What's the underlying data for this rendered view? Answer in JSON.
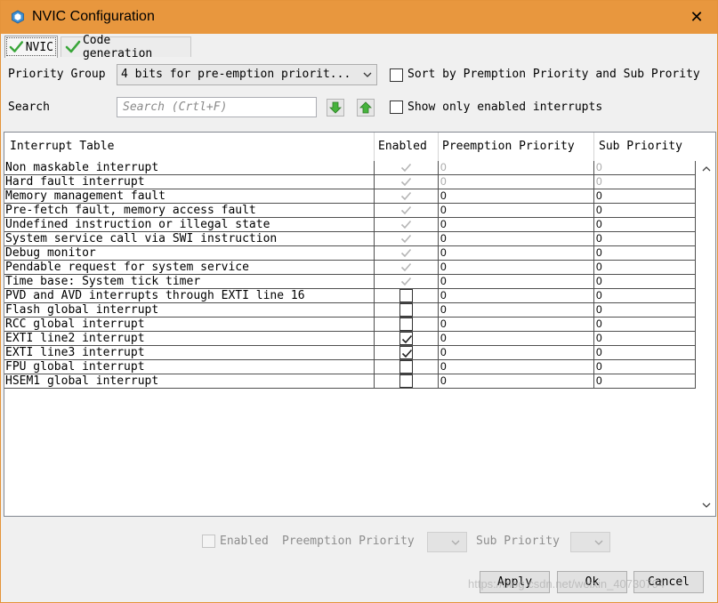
{
  "window": {
    "title": "NVIC Configuration",
    "close_glyph": "✕",
    "accent": "#e8973e"
  },
  "tabs": [
    {
      "label": "NVIC",
      "icon": "green-check-icon"
    },
    {
      "label": "Code generation",
      "icon": "green-check-icon"
    }
  ],
  "controls": {
    "priority_group_label": "Priority Group",
    "priority_group_value": "4 bits for pre-emption priorit...",
    "sort_label": "Sort by Premption Priority and Sub Prority",
    "search_label": "Search",
    "search_placeholder": "Search (Crtl+F)",
    "show_enabled_label": "Show only enabled interrupts"
  },
  "table": {
    "headers": [
      "Interrupt Table",
      "Enabled",
      "Preemption Priority",
      "Sub Priority"
    ],
    "rows": [
      {
        "name": "Non maskable interrupt",
        "enabled": true,
        "locked": true,
        "preemption": "0",
        "sub": "0",
        "pre_dim": true,
        "sub_dim": true
      },
      {
        "name": "Hard fault interrupt",
        "enabled": true,
        "locked": true,
        "preemption": "0",
        "sub": "0",
        "pre_dim": true,
        "sub_dim": true
      },
      {
        "name": "Memory management fault",
        "enabled": true,
        "locked": true,
        "preemption": "0",
        "sub": "0",
        "pre_dim": false,
        "sub_dim": false
      },
      {
        "name": "Pre-fetch fault, memory access fault",
        "enabled": true,
        "locked": true,
        "preemption": "0",
        "sub": "0",
        "pre_dim": false,
        "sub_dim": false
      },
      {
        "name": "Undefined instruction or illegal state",
        "enabled": true,
        "locked": true,
        "preemption": "0",
        "sub": "0",
        "pre_dim": false,
        "sub_dim": false
      },
      {
        "name": "System service call via SWI instruction",
        "enabled": true,
        "locked": true,
        "preemption": "0",
        "sub": "0",
        "pre_dim": false,
        "sub_dim": false
      },
      {
        "name": "Debug monitor",
        "enabled": true,
        "locked": true,
        "preemption": "0",
        "sub": "0",
        "pre_dim": false,
        "sub_dim": false
      },
      {
        "name": "Pendable request for system service",
        "enabled": true,
        "locked": true,
        "preemption": "0",
        "sub": "0",
        "pre_dim": false,
        "sub_dim": false
      },
      {
        "name": "Time base: System tick timer",
        "enabled": true,
        "locked": true,
        "preemption": "0",
        "sub": "0",
        "pre_dim": false,
        "sub_dim": false
      },
      {
        "name": "PVD and AVD interrupts through EXTI line 16",
        "enabled": false,
        "locked": false,
        "preemption": "0",
        "sub": "0",
        "pre_dim": false,
        "sub_dim": false
      },
      {
        "name": "Flash global interrupt",
        "enabled": false,
        "locked": false,
        "preemption": "0",
        "sub": "0",
        "pre_dim": false,
        "sub_dim": false
      },
      {
        "name": "RCC global interrupt",
        "enabled": false,
        "locked": false,
        "preemption": "0",
        "sub": "0",
        "pre_dim": false,
        "sub_dim": false
      },
      {
        "name": "EXTI line2 interrupt",
        "enabled": true,
        "locked": false,
        "preemption": "0",
        "sub": "0",
        "pre_dim": false,
        "sub_dim": false
      },
      {
        "name": "EXTI line3 interrupt",
        "enabled": true,
        "locked": false,
        "preemption": "0",
        "sub": "0",
        "pre_dim": false,
        "sub_dim": false
      },
      {
        "name": "FPU global interrupt",
        "enabled": false,
        "locked": false,
        "preemption": "0",
        "sub": "0",
        "pre_dim": false,
        "sub_dim": false
      },
      {
        "name": "HSEM1 global interrupt",
        "enabled": false,
        "locked": false,
        "preemption": "0",
        "sub": "0",
        "pre_dim": false,
        "sub_dim": false
      }
    ]
  },
  "bottom": {
    "enabled_label": "Enabled",
    "preemption_label": "Preemption Priority",
    "sub_label": "Sub Priority"
  },
  "buttons": {
    "apply": "Apply",
    "ok": "Ok",
    "cancel": "Cancel"
  },
  "watermark": "https://blog.csdn.net/weixin_40730794"
}
